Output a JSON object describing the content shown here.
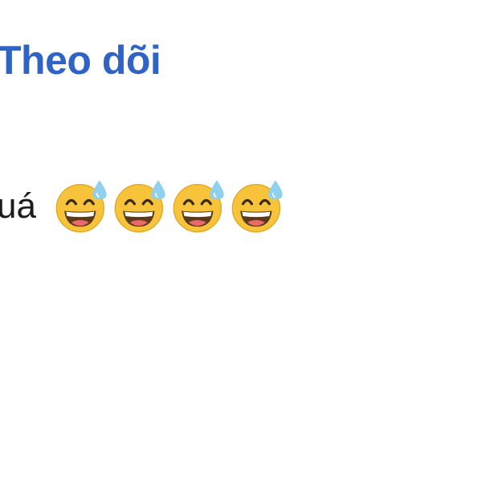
{
  "follow": {
    "label": "Theo dõi",
    "color": "#2f63c6"
  },
  "comment": {
    "text": "uá",
    "emojis": [
      "grinning-face-with-sweat-icon",
      "grinning-face-with-sweat-icon",
      "grinning-face-with-sweat-icon",
      "grinning-face-with-sweat-icon"
    ]
  },
  "colors": {
    "emoji_face": "#f6c33a",
    "emoji_sweat": "#8fd0ee",
    "mouth": "#5a3a1a"
  }
}
